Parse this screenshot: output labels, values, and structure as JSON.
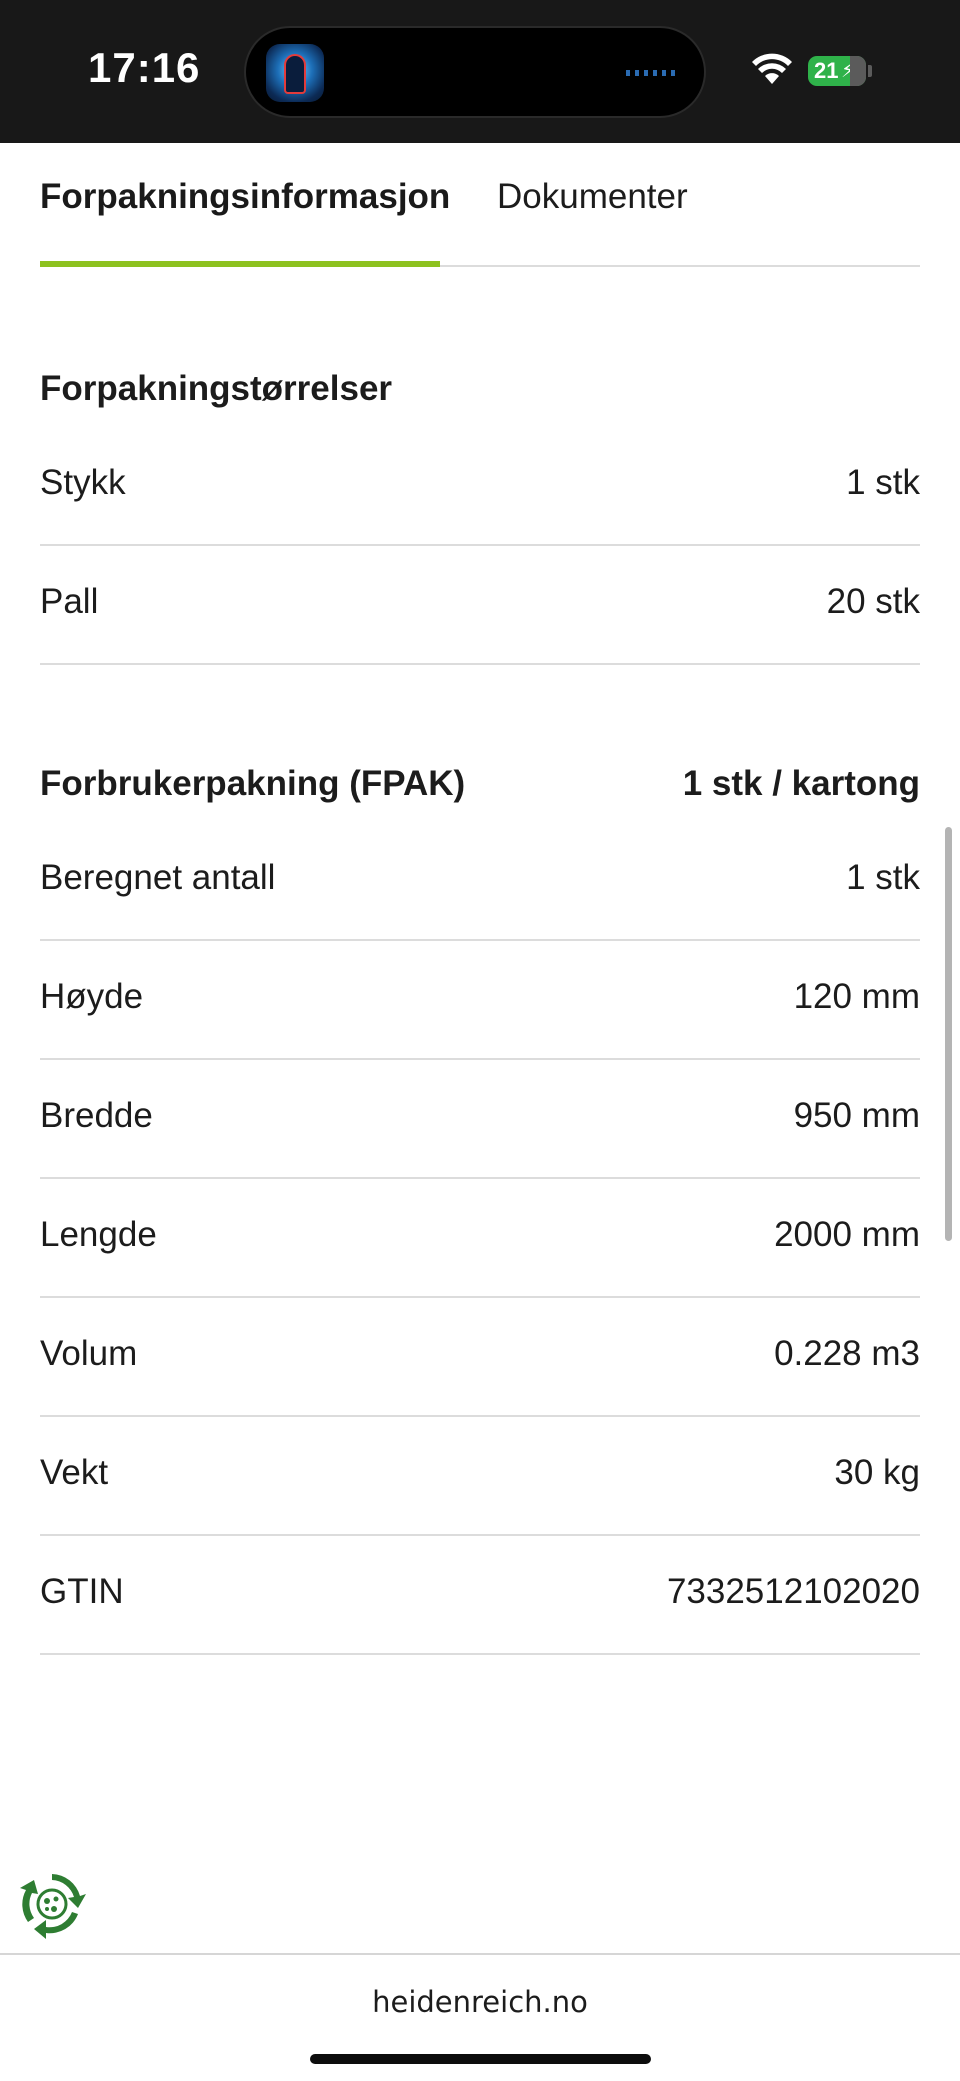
{
  "status_bar": {
    "time": "17:16",
    "battery": "21",
    "icons": [
      "live-activity-app-icon",
      "wifi-icon",
      "battery-icon"
    ]
  },
  "tabs": [
    {
      "label": "Forpakningsinformasjon",
      "active": true
    },
    {
      "label": "Dokumenter",
      "active": false
    }
  ],
  "accent_color": "#8dc21f",
  "packaging_sizes": {
    "title": "Forpakningstørrelser",
    "rows": [
      {
        "label": "Stykk",
        "value": "1 stk"
      },
      {
        "label": "Pall",
        "value": "20 stk"
      }
    ]
  },
  "consumer_package": {
    "title": "Forbrukerpakning (FPAK)",
    "summary": "1 stk / kartong",
    "rows": [
      {
        "label": "Beregnet antall",
        "value": "1 stk"
      },
      {
        "label": "Høyde",
        "value": "120 mm"
      },
      {
        "label": "Bredde",
        "value": "950 mm"
      },
      {
        "label": "Lengde",
        "value": "2000 mm"
      },
      {
        "label": "Volum",
        "value": "0.228 m3"
      },
      {
        "label": "Vekt",
        "value": "30 kg"
      },
      {
        "label": "GTIN",
        "value": "7332512102020"
      }
    ]
  },
  "browser": {
    "url": "heidenreich.no"
  }
}
